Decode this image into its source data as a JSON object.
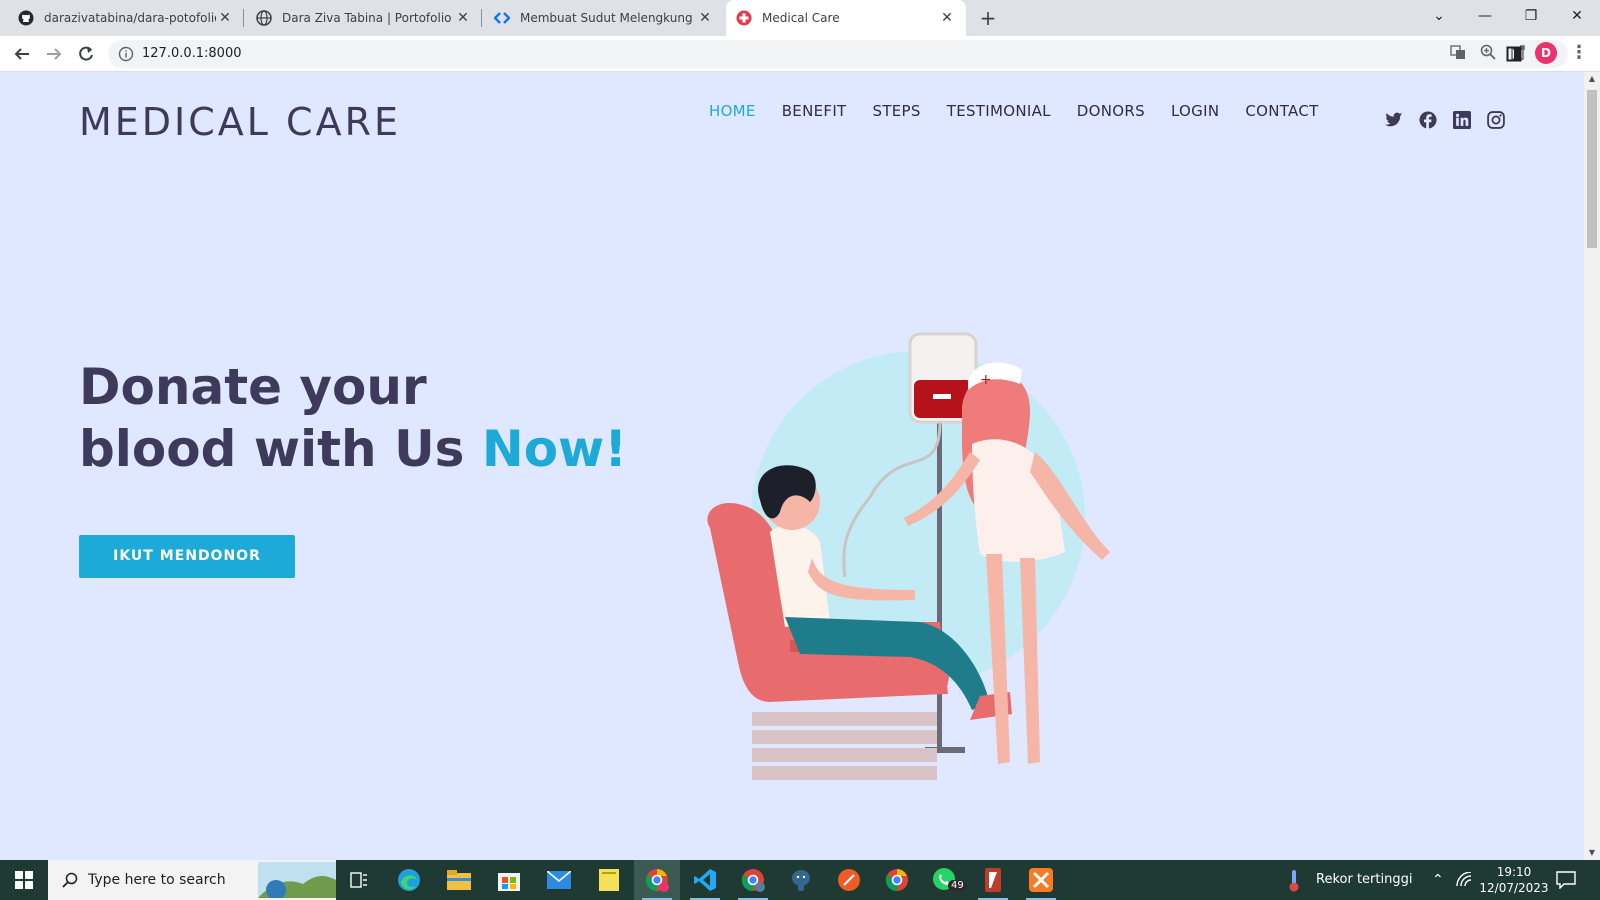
{
  "browser": {
    "tabs": [
      {
        "title": "darazivatabina/dara-potofolio",
        "icon": "github-icon"
      },
      {
        "title": "Dara Ziva Tabina | Portofolio",
        "icon": "globe-icon"
      },
      {
        "title": "Membuat Sudut Melengkung De",
        "icon": "code-icon"
      },
      {
        "title": "Medical Care",
        "icon": "medical-cross-icon"
      }
    ],
    "url": "127.0.0.1:8000",
    "profile_initial": "D"
  },
  "site": {
    "brand": "MEDICAL CARE",
    "nav": [
      "HOME",
      "BENEFIT",
      "STEPS",
      "TESTIMONIAL",
      "DONORS",
      "LOGIN",
      "CONTACT"
    ],
    "active_nav": "HOME",
    "social": [
      "twitter-icon",
      "facebook-icon",
      "linkedin-icon",
      "instagram-icon"
    ],
    "hero": {
      "line1": "Donate your",
      "line2": "blood with Us ",
      "accent": "Now!",
      "cta": "IKUT MENDONOR"
    },
    "colors": {
      "accent": "#1eaad8",
      "heading": "#3d3a5c",
      "background": "#e0e8ff"
    }
  },
  "taskbar": {
    "search_placeholder": "Type here to search",
    "weather": "Rekor tertinggi",
    "time": "19:10",
    "date": "12/07/2023",
    "whatsapp_badge": "49"
  }
}
